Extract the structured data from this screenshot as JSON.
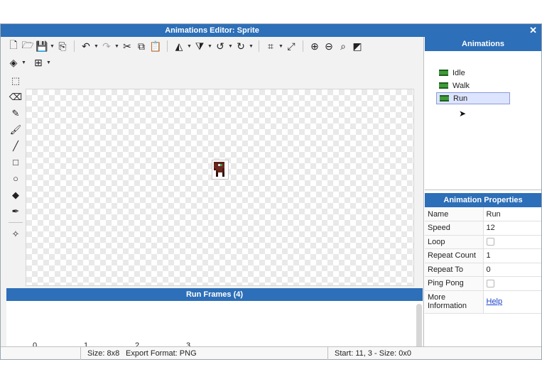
{
  "window": {
    "title": "Animations Editor: Sprite",
    "close_label": "✕"
  },
  "toolbar": {
    "row1": [
      {
        "name": "new-icon",
        "glyph": "🗋"
      },
      {
        "name": "open-icon",
        "glyph": "🗁"
      },
      {
        "name": "save-icon",
        "glyph": "💾"
      },
      {
        "name": "export-icon",
        "glyph": "⎘"
      },
      {
        "name": "undo-icon",
        "glyph": "↶"
      },
      {
        "name": "redo-icon",
        "glyph": "↷"
      },
      {
        "name": "cut-icon",
        "glyph": "✂"
      },
      {
        "name": "copy-icon",
        "glyph": "⧉"
      },
      {
        "name": "paste-icon",
        "glyph": "📋"
      },
      {
        "name": "flip-horizontal-icon",
        "glyph": "◭"
      },
      {
        "name": "flip-vertical-icon",
        "glyph": "⧩"
      },
      {
        "name": "rotate-left-icon",
        "glyph": "↺"
      },
      {
        "name": "rotate-right-icon",
        "glyph": "↻"
      },
      {
        "name": "crop-icon",
        "glyph": "⌗"
      },
      {
        "name": "resize-icon",
        "glyph": "⤢"
      },
      {
        "name": "zoom-in-icon",
        "glyph": "⊕"
      },
      {
        "name": "zoom-out-icon",
        "glyph": "⊖"
      },
      {
        "name": "zoom-reset-icon",
        "glyph": "⌕"
      },
      {
        "name": "invert-icon",
        "glyph": "◩"
      }
    ],
    "row2": [
      {
        "name": "layers-icon",
        "glyph": "◈"
      },
      {
        "name": "grid-icon",
        "glyph": "⊞"
      }
    ]
  },
  "tools": [
    {
      "name": "selection-tool-icon",
      "glyph": "⬚"
    },
    {
      "name": "eraser-tool-icon",
      "glyph": "⌫"
    },
    {
      "name": "pencil-tool-icon",
      "glyph": "✎"
    },
    {
      "name": "brush-tool-icon",
      "glyph": "🖌"
    },
    {
      "name": "line-tool-icon",
      "glyph": "╱"
    },
    {
      "name": "rectangle-tool-icon",
      "glyph": "□"
    },
    {
      "name": "ellipse-tool-icon",
      "glyph": "○"
    },
    {
      "name": "fill-tool-icon",
      "glyph": "◆"
    },
    {
      "name": "eyedropper-tool-icon",
      "glyph": "✒"
    },
    {
      "name": "move-tool-icon",
      "glyph": "✧"
    }
  ],
  "frames": {
    "title": "Run Frames (4)",
    "labels": [
      "0",
      "1",
      "2",
      "3"
    ]
  },
  "animations": {
    "title": "Animations",
    "items": [
      {
        "label": "Idle",
        "selected": false
      },
      {
        "label": "Walk",
        "selected": false
      },
      {
        "label": "Run",
        "selected": true
      }
    ]
  },
  "properties": {
    "title": "Animation Properties",
    "rows": [
      {
        "key": "Name",
        "value": "Run"
      },
      {
        "key": "Speed",
        "value": "12"
      },
      {
        "key": "Loop",
        "checkbox": true
      },
      {
        "key": "Repeat Count",
        "value": "1"
      },
      {
        "key": "Repeat To",
        "value": "0"
      },
      {
        "key": "Ping Pong",
        "checkbox": true
      },
      {
        "key": "More Information",
        "link": "Help"
      }
    ]
  },
  "status": {
    "size": "Size: 8x8",
    "format": "Export Format: PNG",
    "start": "Start: 11, 3 - Size: 0x0"
  },
  "colors": {
    "accent": "#2d6fb8",
    "selection": "#dde4ff"
  }
}
